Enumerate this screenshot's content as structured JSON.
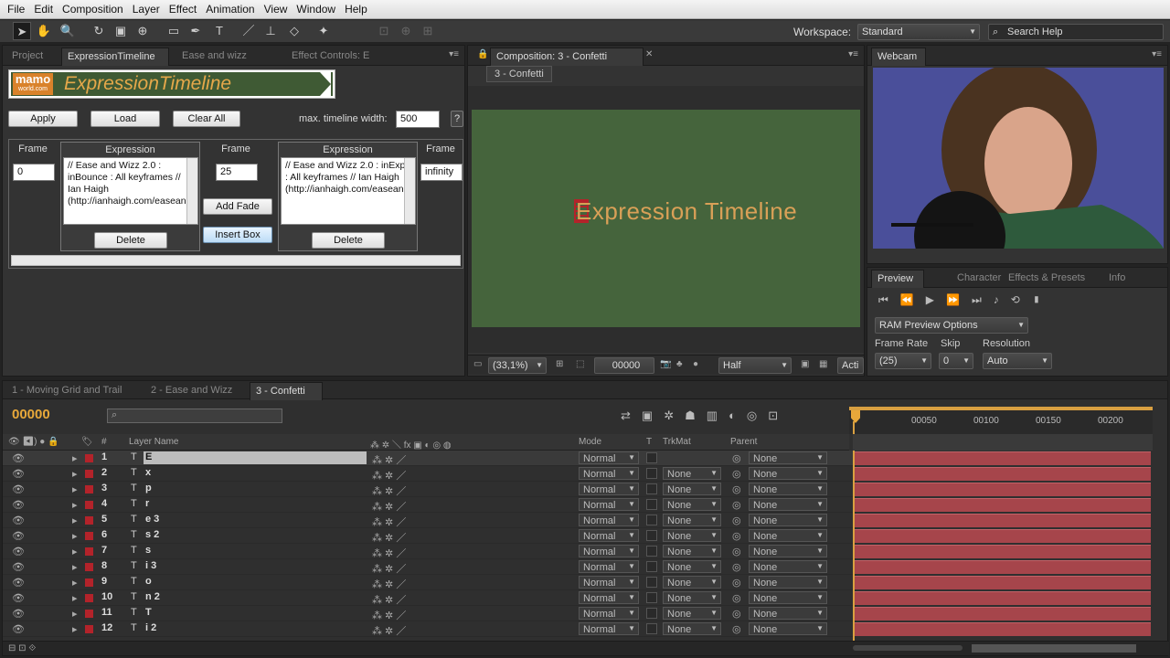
{
  "menu": [
    "File",
    "Edit",
    "Composition",
    "Layer",
    "Effect",
    "Animation",
    "View",
    "Window",
    "Help"
  ],
  "workspace": {
    "label": "Workspace:",
    "value": "Standard",
    "search_placeholder": "Search Help"
  },
  "left_panel": {
    "tabs": [
      "Project",
      "ExpressionTimeline",
      "Ease and wizz",
      "Effect Controls: E"
    ],
    "logo_badge": "mamo",
    "logo_sub": "world.com",
    "logo_title": "ExpressionTimeline",
    "buttons": {
      "apply": "Apply",
      "load": "Load",
      "clear_all": "Clear All",
      "help": "?"
    },
    "max_width_label": "max. timeline width:",
    "max_width_value": "500",
    "frame_label": "Frame",
    "expression_label": "Expression",
    "columns": [
      {
        "frame": "0",
        "expr": "// Ease and Wizz 2.0 : inBounce : All keyframes // Ian Haigh (http://ianhaigh.com/easeandwizz/)",
        "delete": "Delete"
      },
      {
        "frame": "25",
        "expr": "// Ease and Wizz 2.0 : inExpo : All keyframes // Ian Haigh (http://ianhaigh.com/easeandwizz/)",
        "delete": "Delete"
      },
      {
        "frame": "infinity"
      }
    ],
    "add_fade": "Add Fade",
    "insert_box": "Insert Box"
  },
  "comp_panel": {
    "tab": "Composition: 3 - Confetti",
    "breadcrumb": "3 - Confetti",
    "canvas_text": "Expression Timeline",
    "zoom": "(33,1%)",
    "timecode": "00000",
    "resolution": "Half",
    "active_camera": "Acti",
    "bg_color": "#45643c",
    "text_color": "#d9a057"
  },
  "webcam_panel": {
    "tab": "Webcam"
  },
  "preview_panel": {
    "tabs": [
      "Preview",
      "Character",
      "Effects & Presets",
      "Info"
    ],
    "ram_options": "RAM Preview Options",
    "frame_rate_label": "Frame Rate",
    "frame_rate": "(25)",
    "skip_label": "Skip",
    "skip": "0",
    "resolution_label": "Resolution",
    "resolution": "Auto"
  },
  "timeline": {
    "tabs": [
      "1 - Moving Grid and Trail",
      "2 - Ease and Wizz",
      "3 - Confetti"
    ],
    "timecode": "00000",
    "search_placeholder": "",
    "columns": {
      "layer_name": "Layer Name",
      "mode": "Mode",
      "t": "T",
      "trkmat": "TrkMat",
      "parent": "Parent",
      "hash": "#"
    },
    "ruler": [
      "00050",
      "00100",
      "00150",
      "00200"
    ],
    "layers": [
      {
        "num": "1",
        "name": "E",
        "mode": "Normal",
        "trkmat": "",
        "parent": "None"
      },
      {
        "num": "2",
        "name": "x",
        "mode": "Normal",
        "trkmat": "None",
        "parent": "None"
      },
      {
        "num": "3",
        "name": "p",
        "mode": "Normal",
        "trkmat": "None",
        "parent": "None"
      },
      {
        "num": "4",
        "name": "r",
        "mode": "Normal",
        "trkmat": "None",
        "parent": "None"
      },
      {
        "num": "5",
        "name": "e 3",
        "mode": "Normal",
        "trkmat": "None",
        "parent": "None"
      },
      {
        "num": "6",
        "name": "s 2",
        "mode": "Normal",
        "trkmat": "None",
        "parent": "None"
      },
      {
        "num": "7",
        "name": "s",
        "mode": "Normal",
        "trkmat": "None",
        "parent": "None"
      },
      {
        "num": "8",
        "name": "i 3",
        "mode": "Normal",
        "trkmat": "None",
        "parent": "None"
      },
      {
        "num": "9",
        "name": "o",
        "mode": "Normal",
        "trkmat": "None",
        "parent": "None"
      },
      {
        "num": "10",
        "name": "n 2",
        "mode": "Normal",
        "trkmat": "None",
        "parent": "None"
      },
      {
        "num": "11",
        "name": "T",
        "mode": "Normal",
        "trkmat": "None",
        "parent": "None"
      },
      {
        "num": "12",
        "name": "i 2",
        "mode": "Normal",
        "trkmat": "None",
        "parent": "None"
      }
    ]
  }
}
